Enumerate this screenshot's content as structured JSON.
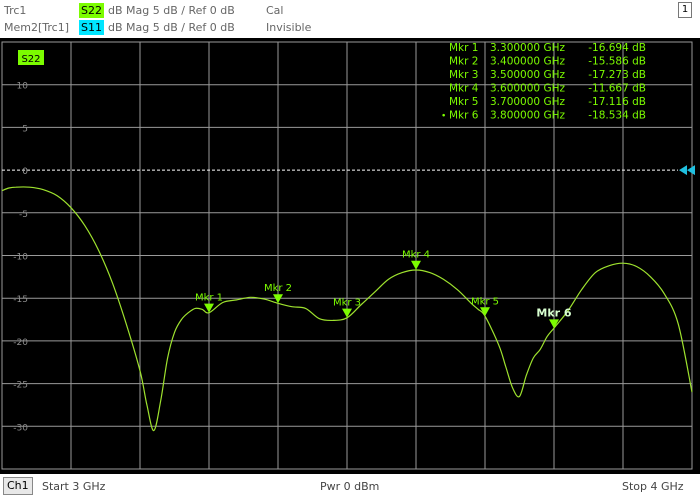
{
  "header": {
    "traces": [
      {
        "name": "Trc1",
        "param": "S22",
        "param_color": "#7cfc00",
        "format": "dB Mag  5 dB /  Ref 0 dB",
        "state": "Cal"
      },
      {
        "name": "Mem2[Trc1]",
        "param": "S11",
        "param_color": "#00e5ff",
        "format": "dB Mag  5 dB /  Ref 0 dB",
        "state": "Invisible"
      }
    ],
    "window_number": "1"
  },
  "plot": {
    "trace_tag": "S22",
    "ref_level_label": "0",
    "markers": [
      {
        "name": "Mkr 1",
        "freq": "3.300000 GHz",
        "value": "-16.694 dB"
      },
      {
        "name": "Mkr 2",
        "freq": "3.400000 GHz",
        "value": "-15.586 dB"
      },
      {
        "name": "Mkr 3",
        "freq": "3.500000 GHz",
        "value": "-17.273 dB"
      },
      {
        "name": "Mkr 4",
        "freq": "3.600000 GHz",
        "value": "-11.667 dB"
      },
      {
        "name": "Mkr 5",
        "freq": "3.700000 GHz",
        "value": "-17.116 dB"
      },
      {
        "name": "Mkr 6",
        "freq": "3.800000 GHz",
        "value": "-18.534 dB",
        "active": true
      }
    ]
  },
  "footer": {
    "channel": "Ch1",
    "start": "Start  3 GHz",
    "power": "Pwr  0 dBm",
    "stop": "Stop  4 GHz"
  },
  "chart_data": {
    "type": "line",
    "xlim": [
      3.0,
      4.0
    ],
    "ylim": [
      -35,
      15
    ],
    "y_ticks": [
      10,
      5,
      0,
      -5,
      -10,
      -15,
      -20,
      -25,
      -30
    ],
    "x_divisions": 10,
    "grid": true,
    "colors": {
      "trace": "#9ee22e",
      "grid": "#9a9a9a",
      "marker": "#7cfc00",
      "ref_line": "#ffffff",
      "ref_arrow": "#20c0e0"
    },
    "series": [
      {
        "name": "S22",
        "x": [
          3.0,
          3.01,
          3.02,
          3.04,
          3.06,
          3.08,
          3.1,
          3.12,
          3.14,
          3.16,
          3.18,
          3.2,
          3.21,
          3.22,
          3.23,
          3.24,
          3.25,
          3.26,
          3.27,
          3.28,
          3.29,
          3.3,
          3.32,
          3.34,
          3.36,
          3.38,
          3.4,
          3.42,
          3.44,
          3.46,
          3.48,
          3.5,
          3.52,
          3.54,
          3.56,
          3.58,
          3.6,
          3.62,
          3.64,
          3.66,
          3.68,
          3.69,
          3.7,
          3.72,
          3.73,
          3.74,
          3.75,
          3.76,
          3.77,
          3.78,
          3.79,
          3.8,
          3.82,
          3.84,
          3.86,
          3.88,
          3.9,
          3.92,
          3.94,
          3.96,
          3.98,
          4.0
        ],
        "values": [
          -2.4,
          -2.1,
          -2.0,
          -2.0,
          -2.3,
          -3.0,
          -4.4,
          -6.5,
          -9.4,
          -13.2,
          -18.0,
          -23.5,
          -27.5,
          -30.5,
          -27.0,
          -22.0,
          -19.0,
          -17.5,
          -16.7,
          -16.2,
          -16.3,
          -16.7,
          -15.5,
          -15.2,
          -14.9,
          -15.1,
          -15.6,
          -16.0,
          -16.2,
          -17.4,
          -17.6,
          -17.3,
          -15.8,
          -14.3,
          -12.8,
          -12.0,
          -11.7,
          -12.0,
          -12.8,
          -14.0,
          -15.6,
          -16.3,
          -17.1,
          -20.5,
          -23.0,
          -25.5,
          -26.5,
          -24.0,
          -22.0,
          -21.0,
          -19.5,
          -18.5,
          -16.5,
          -14.0,
          -12.0,
          -11.2,
          -10.9,
          -11.3,
          -12.5,
          -14.5,
          -18.0,
          -26.0
        ]
      }
    ]
  }
}
